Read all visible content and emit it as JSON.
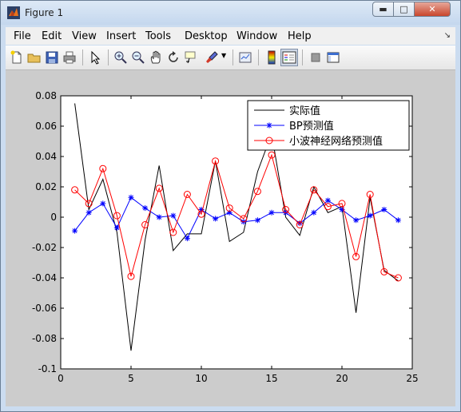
{
  "window": {
    "title": "Figure 1",
    "min_glyph": "▬",
    "max_glyph": "□",
    "close_glyph": "✕"
  },
  "menu": {
    "items": [
      "File",
      "Edit",
      "View",
      "Insert",
      "Tools",
      "Desktop",
      "Window",
      "Help"
    ],
    "dock_glyph": "↘"
  },
  "toolbar": {
    "buttons": [
      "new-figure-icon",
      "open-file-icon",
      "save-icon",
      "print-icon",
      "edit-plot-icon",
      "zoom-in-icon",
      "zoom-out-icon",
      "pan-icon",
      "rotate-3d-icon",
      "data-cursor-icon",
      "brush-icon",
      "link-plot-icon",
      "colorbar-icon",
      "legend-icon",
      "hide-plot-tools-icon",
      "show-plot-tools-icon"
    ]
  },
  "colors": {
    "actual": "#000000",
    "bp": "#0000ff",
    "wavelet": "#ff0000",
    "canvas": "#cccccc",
    "axes": "#ffffff"
  },
  "chart_data": {
    "type": "line",
    "title": "",
    "xlabel": "",
    "ylabel": "",
    "xlim": [
      0,
      25
    ],
    "ylim": [
      -0.1,
      0.08
    ],
    "xticks": [
      0,
      5,
      10,
      15,
      20,
      25
    ],
    "yticks": [
      -0.1,
      -0.08,
      -0.06,
      -0.04,
      -0.02,
      0,
      0.02,
      0.04,
      0.06,
      0.08
    ],
    "ytick_labels": [
      "-0.1",
      "-0.08",
      "-0.06",
      "-0.04",
      "-0.02",
      "0",
      "0.02",
      "0.04",
      "0.06",
      "0.08"
    ],
    "grid": false,
    "legend_position": "top-right",
    "x": [
      1,
      2,
      3,
      4,
      5,
      6,
      7,
      8,
      9,
      10,
      11,
      12,
      13,
      14,
      15,
      16,
      17,
      18,
      19,
      20,
      21,
      22,
      23,
      24
    ],
    "series": [
      {
        "name": "实际值",
        "color": "#000000",
        "marker": "none",
        "values": [
          0.075,
          0.005,
          0.025,
          -0.01,
          -0.088,
          -0.015,
          0.034,
          -0.022,
          -0.011,
          -0.011,
          0.037,
          -0.016,
          -0.01,
          0.03,
          0.055,
          0.0,
          -0.012,
          0.02,
          0.003,
          0.007,
          -0.063,
          0.013,
          -0.035,
          -0.042
        ]
      },
      {
        "name": "BP预测值",
        "color": "#0000ff",
        "marker": "star",
        "values": [
          -0.009,
          0.003,
          0.009,
          -0.007,
          0.013,
          0.006,
          0.0,
          0.001,
          -0.014,
          0.005,
          -0.001,
          0.003,
          -0.003,
          -0.002,
          0.003,
          0.003,
          -0.004,
          0.003,
          0.011,
          0.005,
          -0.002,
          0.001,
          0.005,
          -0.002
        ]
      },
      {
        "name": "小波神经网络预测值",
        "color": "#ff0000",
        "marker": "circle",
        "values": [
          0.018,
          0.009,
          0.032,
          0.001,
          -0.039,
          -0.005,
          0.019,
          -0.01,
          0.015,
          0.002,
          0.037,
          0.006,
          -0.001,
          0.017,
          0.041,
          0.005,
          -0.005,
          0.018,
          0.007,
          0.009,
          -0.026,
          0.015,
          -0.036,
          -0.04
        ]
      }
    ]
  }
}
